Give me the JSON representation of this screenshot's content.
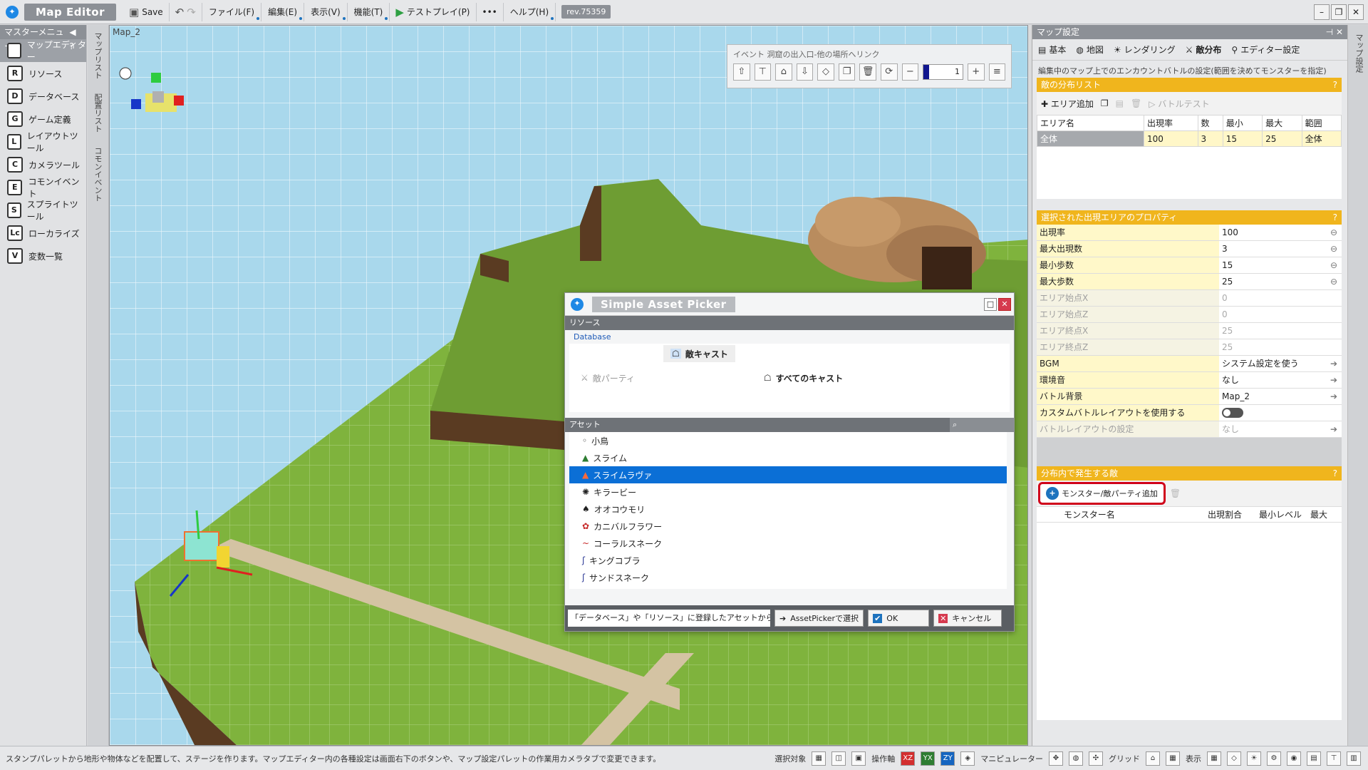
{
  "app": {
    "title": "Map Editor",
    "rev": "rev.75359"
  },
  "toolbar": {
    "save": "Save",
    "menus": [
      "ファイル(F)",
      "編集(E)",
      "表示(V)",
      "機能(T)"
    ],
    "testplay": "テストプレイ(P)",
    "more": "•••",
    "help": "ヘルプ(H)"
  },
  "leftmenu": {
    "header": "マスターメニュー",
    "items": [
      {
        "label": "マップエディター",
        "icon": "M"
      },
      {
        "label": "リソース",
        "icon": "R"
      },
      {
        "label": "データベース",
        "icon": "D"
      },
      {
        "label": "ゲーム定義",
        "icon": "G"
      },
      {
        "label": "レイアウトツール",
        "icon": "L"
      },
      {
        "label": "カメラツール",
        "icon": "C"
      },
      {
        "label": "コモンイベント",
        "icon": "E"
      },
      {
        "label": "スプライトツール",
        "icon": "S"
      },
      {
        "label": "ローカライズ",
        "icon": "Lc"
      },
      {
        "label": "変数一覧",
        "icon": "V"
      }
    ]
  },
  "vtabs": [
    "マップリスト",
    "配置リスト",
    "コモンイベント"
  ],
  "viewport": {
    "label": "Map_2",
    "event_title": "イベント 洞窟の出入口-他の場所へリンク",
    "counter": "1"
  },
  "dialog": {
    "title": "Simple Asset Picker",
    "resource_section": "リソース",
    "database_label": "Database",
    "resources": [
      {
        "label": "敵パーティ",
        "state": "disabled"
      },
      {
        "label": "敵キャスト",
        "state": "selected"
      },
      {
        "label": "すべてのキャスト",
        "state": "normal"
      }
    ],
    "asset_section": "アセット",
    "assets": [
      "小鳥",
      "スライム",
      "スライムラヴァ",
      "キラービー",
      "オオコウモリ",
      "カニバルフラワー",
      "コーラルスネーク",
      "キングコブラ",
      "サンドスネーク"
    ],
    "selected_asset": "スライムラヴァ",
    "footer_msg": "「データベース」や「リソース」に登録したアセットから、指定",
    "btn_assetpicker": "AssetPickerで選択",
    "btn_ok": "OK",
    "btn_cancel": "キャンセル"
  },
  "rightpanel": {
    "header": "マップ設定",
    "tabs": [
      "基本",
      "地図",
      "レンダリング",
      "敵分布",
      "エディター設定"
    ],
    "active_tab": "敵分布",
    "description": "編集中のマップ上でのエンカウントバトルの設定(範囲を決めてモンスターを指定)",
    "dist_list_title": "敵の分布リスト",
    "btn_add_area": "エリア追加",
    "btn_battletest": "バトルテスト",
    "table_headers": [
      "エリア名",
      "出現率",
      "数",
      "最小",
      "最大",
      "範囲"
    ],
    "table_rows": [
      [
        "全体",
        "100",
        "3",
        "15",
        "25",
        "全体"
      ]
    ],
    "props_title": "選択された出現エリアのプロパティ",
    "props": [
      {
        "k": "出現率",
        "v": "100",
        "state": "edit"
      },
      {
        "k": "最大出現数",
        "v": "3",
        "state": "edit"
      },
      {
        "k": "最小歩数",
        "v": "15",
        "state": "edit"
      },
      {
        "k": "最大歩数",
        "v": "25",
        "state": "edit"
      },
      {
        "k": "エリア始点X",
        "v": "0",
        "state": "disabled"
      },
      {
        "k": "エリア始点Z",
        "v": "0",
        "state": "disabled"
      },
      {
        "k": "エリア終点X",
        "v": "25",
        "state": "disabled"
      },
      {
        "k": "エリア終点Z",
        "v": "25",
        "state": "disabled"
      },
      {
        "k": "BGM",
        "v": "システム設定を使う",
        "state": "arrow"
      },
      {
        "k": "環境音",
        "v": "なし",
        "state": "arrow"
      },
      {
        "k": "バトル背景",
        "v": "Map_2",
        "state": "arrow"
      },
      {
        "k": "カスタムバトルレイアウトを使用する",
        "v": "",
        "state": "toggle"
      },
      {
        "k": "バトルレイアウトの設定",
        "v": "なし",
        "state": "disabled-arrow"
      }
    ],
    "enemies_title": "分布内で発生する敵",
    "btn_add_monster": "モンスター/敵パーティ追加",
    "enemy_headers": [
      "モンスター名",
      "出現割合",
      "最小レベル",
      "最大"
    ],
    "side_tab": "マップ設定"
  },
  "status": {
    "message": "スタンプパレットから地形や物体などを配置して、ステージを作ります。マップエディター内の各種設定は画面右下のボタンや、マップ設定パレットの作業用カメラタブで変更できます。",
    "labels": [
      "選択対象",
      "操作軸",
      "マニピュレーター",
      "グリッド",
      "表示"
    ],
    "axis": [
      "XZ",
      "YX",
      "ZY"
    ]
  },
  "colors": {
    "accent": "#f0b51d",
    "selection": "#0b6fd6",
    "highlight": "#d0021b"
  }
}
